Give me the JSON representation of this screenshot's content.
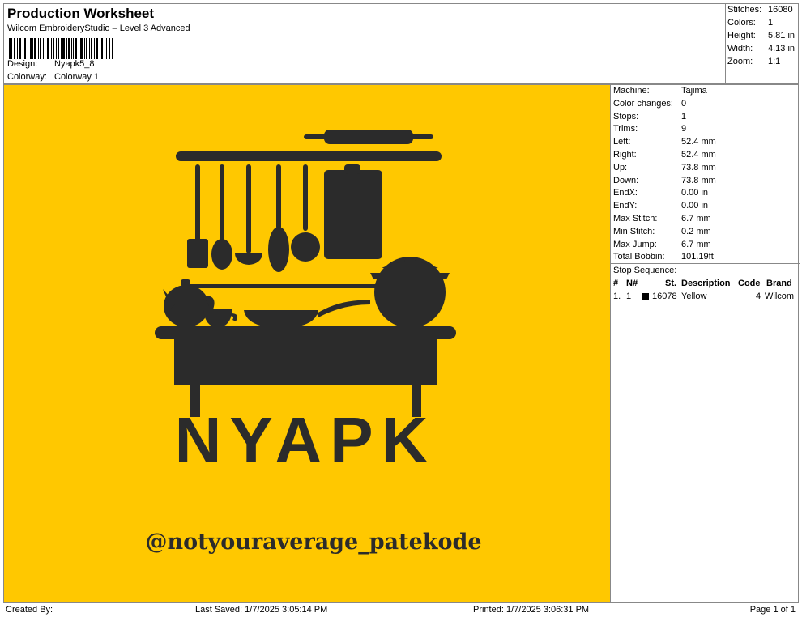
{
  "header": {
    "title": "Production Worksheet",
    "subtitle": "Wilcom EmbroideryStudio – Level 3 Advanced",
    "design_label": "Design:",
    "design_value": "Nyapk5_8",
    "colorway_label": "Colorway:",
    "colorway_value": "Colorway 1"
  },
  "summary": {
    "stitches_label": "Stitches:",
    "stitches_value": "16080",
    "colors_label": "Colors:",
    "colors_value": "1",
    "height_label": "Height:",
    "height_value": "5.81 in",
    "width_label": "Width:",
    "width_value": "4.13 in",
    "zoom_label": "Zoom:",
    "zoom_value": "1:1"
  },
  "design": {
    "background_color": "#FFC800",
    "stitch_color": "#2b2b2b",
    "logo_text": "NYAPK",
    "handle_text": "@notyouraverage_patekode"
  },
  "machine": [
    {
      "label": "Machine:",
      "value": "Tajima"
    },
    {
      "label": "Color changes:",
      "value": "0"
    },
    {
      "label": "Stops:",
      "value": "1"
    },
    {
      "label": "Trims:",
      "value": "9"
    },
    {
      "label": "Left:",
      "value": "52.4 mm"
    },
    {
      "label": "Right:",
      "value": "52.4 mm"
    },
    {
      "label": "Up:",
      "value": "73.8 mm"
    },
    {
      "label": "Down:",
      "value": "73.8 mm"
    },
    {
      "label": "EndX:",
      "value": "0.00 in"
    },
    {
      "label": "EndY:",
      "value": "0.00 in"
    },
    {
      "label": "Max Stitch:",
      "value": "6.7 mm"
    },
    {
      "label": "Min Stitch:",
      "value": "0.2 mm"
    },
    {
      "label": "Max Jump:",
      "value": "6.7 mm"
    },
    {
      "label": "Total Bobbin:",
      "value": "101.19ft"
    }
  ],
  "stop_sequence": {
    "title": "Stop Sequence:",
    "headers": {
      "num": "#",
      "n": "N#",
      "st": "St.",
      "desc": "Description",
      "code": "Code",
      "brand": "Brand"
    },
    "rows": [
      {
        "num": "1.",
        "n": "1",
        "swatch": "#000000",
        "st": "16078",
        "desc": "Yellow",
        "code": "4",
        "brand": "Wilcom"
      }
    ]
  },
  "footer": {
    "created": "Created By:",
    "saved": "Last Saved: 1/7/2025 3:05:14 PM",
    "printed": "Printed: 1/7/2025 3:06:31 PM",
    "page": "Page 1 of 1"
  }
}
